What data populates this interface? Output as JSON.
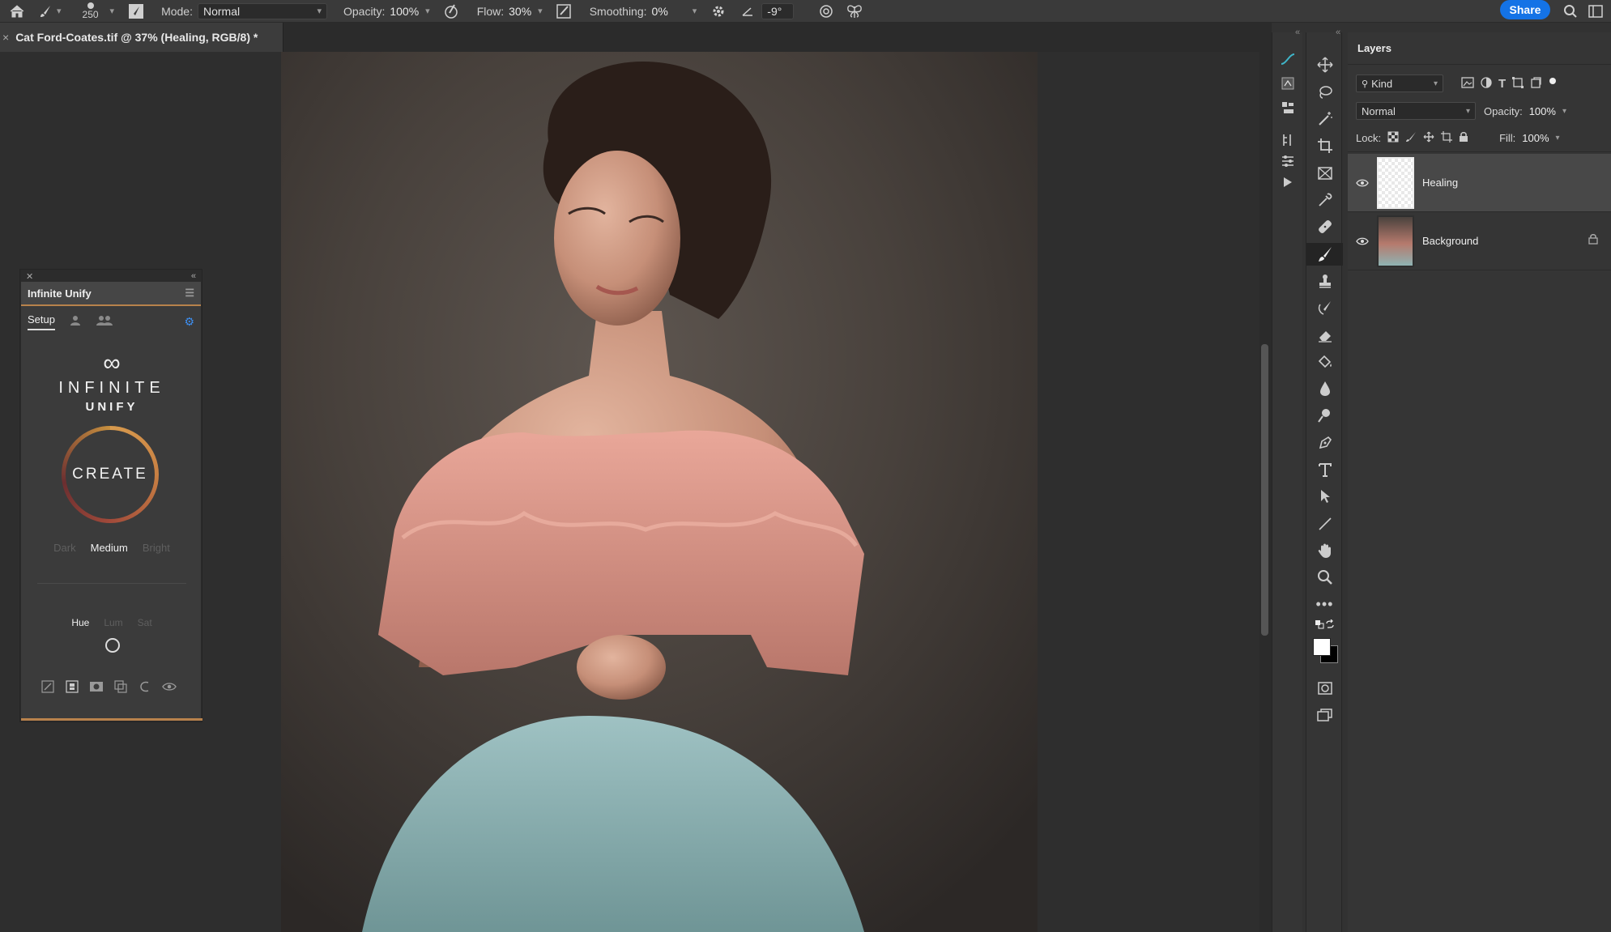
{
  "options_bar": {
    "brush_size": "250",
    "mode_label": "Mode:",
    "mode_value": "Normal",
    "opacity_label": "Opacity:",
    "opacity_value": "100%",
    "flow_label": "Flow:",
    "flow_value": "30%",
    "smoothing_label": "Smoothing:",
    "smoothing_value": "0%",
    "angle_value": "-9°",
    "share_label": "Share"
  },
  "document": {
    "tab_title": "Cat Ford-Coates.tif @ 37% (Healing, RGB/8) *",
    "close_symbol": "×"
  },
  "plugin": {
    "title": "Infinite Unify",
    "tab_setup": "Setup",
    "logo_symbol": "∞",
    "logo_word1": "INFINITE",
    "logo_word2": "UNIFY",
    "create_label": "CREATE",
    "tone_options": [
      "Dark",
      "Medium",
      "Bright"
    ],
    "tone_selected": "Medium",
    "adjust_options": [
      "Hue",
      "Lum",
      "Sat"
    ],
    "adjust_selected": "Hue",
    "accent_color": "#b8824c"
  },
  "layers_panel": {
    "title": "Layers",
    "filter_kind": "Kind",
    "blend_mode": "Normal",
    "opacity_label": "Opacity:",
    "opacity_value": "100%",
    "lock_label": "Lock:",
    "fill_label": "Fill:",
    "fill_value": "100%",
    "layers": [
      {
        "name": "Healing",
        "selected": true,
        "locked": false
      },
      {
        "name": "Background",
        "selected": false,
        "locked": true
      }
    ]
  },
  "colors": {
    "share_blue": "#1473e6",
    "panel_bg": "#353535",
    "canvas_bg": "#2e2e2e"
  }
}
